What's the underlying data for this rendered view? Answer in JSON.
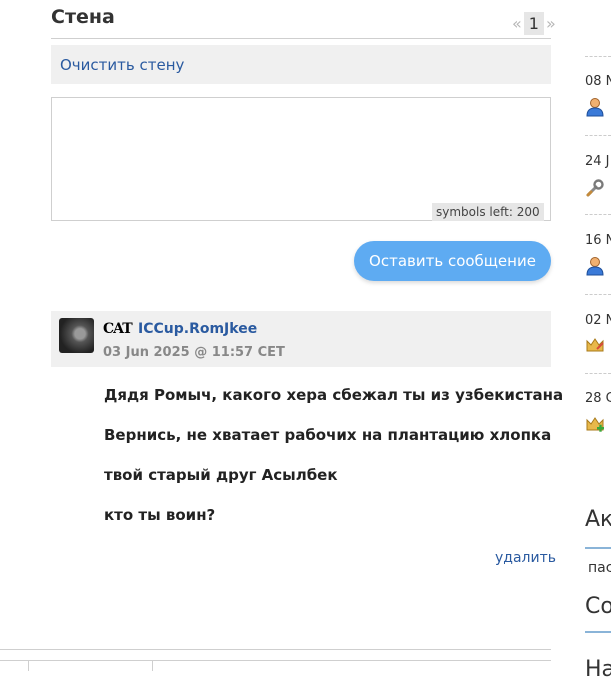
{
  "wall": {
    "title": "Стена",
    "pager": {
      "prev": "«",
      "current": "1",
      "next": "»"
    },
    "clear_label": "Очистить стену",
    "textarea_value": "",
    "symbols_left": "symbols left: 200",
    "submit_label": "Оставить сообщение"
  },
  "post": {
    "clan_tag": "CAT",
    "author": "ICCup.RomJkee",
    "date": "03 Jun 2025 @ 11:57 CET",
    "lines": [
      "Дядя Ромыч, какого хера сбежал ты из узбекистана",
      "Вернись, не хватает рабочих на плантацию хлопка",
      "твой старый друг Асылбек",
      "кто ты воин?"
    ],
    "delete_label": "удалить"
  },
  "sidebar": {
    "events": [
      {
        "date": "08 N",
        "icon": "user-icon"
      },
      {
        "date": "24 J",
        "icon": "wrench-icon"
      },
      {
        "date": "16 N",
        "icon": "user-icon"
      },
      {
        "date": "02 N",
        "icon": "crown-icon"
      },
      {
        "date": "28 C",
        "icon": "crown-plus-icon"
      }
    ],
    "heading_1": "Ак",
    "text_1": "пас",
    "heading_2": "Со",
    "heading_3": "На"
  },
  "colors": {
    "link": "#2a5aa0",
    "button": "#5eabf2",
    "panel": "#f0f0f0",
    "accent_rule": "#8ab4d8"
  }
}
